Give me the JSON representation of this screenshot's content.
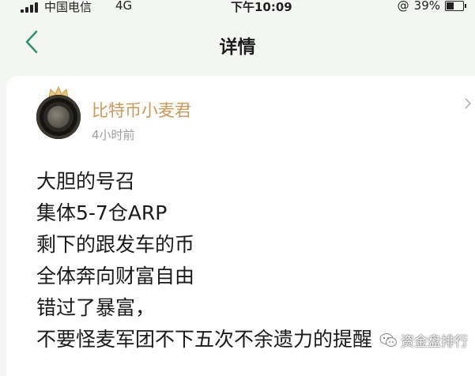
{
  "status_bar": {
    "carrier": "中国电信",
    "network": "4G",
    "time": "下午10:09",
    "battery": "39%",
    "battery_level": 0.39
  },
  "nav": {
    "title": "详情"
  },
  "post": {
    "author": "比特币小麦君",
    "time_ago": "4小时前",
    "lines": [
      "大胆的号召",
      "集体5-7仓ARP",
      "剩下的跟发车的币",
      "全体奔向财富自由",
      "错过了暴富，",
      "不要怪麦军团不下五次不余遗力的提醒"
    ]
  },
  "watermark": {
    "text": "资金盘排行"
  }
}
